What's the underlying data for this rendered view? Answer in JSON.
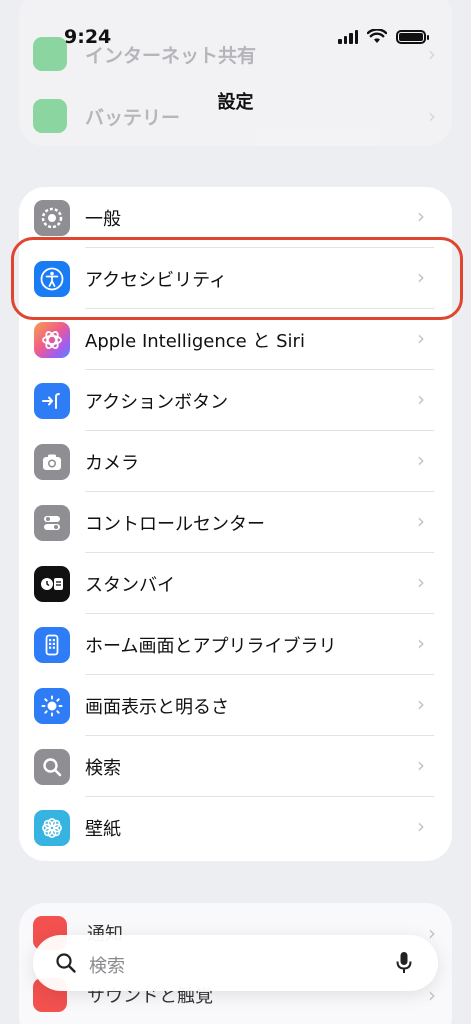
{
  "status_bar": {
    "time": "9:24"
  },
  "nav": {
    "title": "設定"
  },
  "top_group": {
    "items": [
      {
        "label": "インターネット共有"
      },
      {
        "label": "バッテリー"
      }
    ]
  },
  "main_group": {
    "items": [
      {
        "label": "一般",
        "icon": "gear-icon",
        "color": "#8e8e93"
      },
      {
        "label": "アクセシビリティ",
        "icon": "accessibility-icon",
        "color": "#1a7cf5",
        "highlighted": true
      },
      {
        "label": "Apple Intelligence と Siri",
        "icon": "apple-intelligence-icon",
        "color": "#f46b8c"
      },
      {
        "label": "アクションボタン",
        "icon": "action-button-icon",
        "color": "#2f7df6"
      },
      {
        "label": "カメラ",
        "icon": "camera-icon",
        "color": "#8e8e93"
      },
      {
        "label": "コントロールセンター",
        "icon": "control-center-icon",
        "color": "#8e8e93"
      },
      {
        "label": "スタンバイ",
        "icon": "standby-icon",
        "color": "#111111"
      },
      {
        "label": "ホーム画面とアプリライブラリ",
        "icon": "home-screen-icon",
        "color": "#2f7df6"
      },
      {
        "label": "画面表示と明るさ",
        "icon": "brightness-icon",
        "color": "#2f7df6"
      },
      {
        "label": "検索",
        "icon": "search-icon",
        "color": "#8e8e93"
      },
      {
        "label": "壁紙",
        "icon": "wallpaper-icon",
        "color": "#36b3e0"
      }
    ]
  },
  "bottom_group": {
    "items": [
      {
        "label": "通知"
      },
      {
        "label": "サウンドと触覚"
      }
    ]
  },
  "search": {
    "placeholder": "検索"
  },
  "highlight_color": "#e0452f"
}
